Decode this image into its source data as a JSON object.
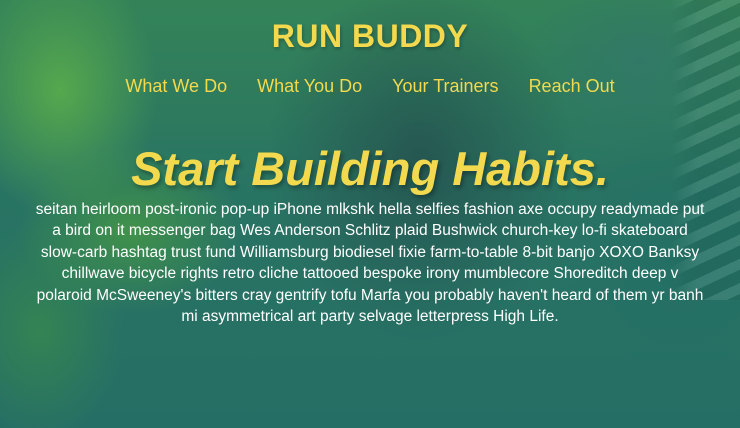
{
  "header": {
    "brand": "RUN BUDDY",
    "nav": [
      {
        "label": "What We Do"
      },
      {
        "label": "What You Do"
      },
      {
        "label": "Your Trainers"
      },
      {
        "label": "Reach Out"
      }
    ]
  },
  "hero": {
    "title": "Start Building Habits.",
    "body": "seitan heirloom post-ironic pop-up iPhone mlkshk hella selfies fashion axe occupy readymade put a bird on it messenger bag Wes Anderson Schlitz plaid Bushwick church-key lo-fi skateboard slow-carb hashtag trust fund Williamsburg biodiesel fixie farm-to-table 8-bit banjo XOXO Banksy chillwave bicycle rights retro cliche tattooed bespoke irony mumblecore Shoreditch deep v polaroid McSweeney's bitters cray gentrify tofu Marfa you probably haven't heard of them yr banh mi asymmetrical art party selvage letterpress High Life."
  },
  "colors": {
    "accent": "#f2d94e",
    "text": "#ffffff",
    "background_tint": "#2f6e5e"
  }
}
